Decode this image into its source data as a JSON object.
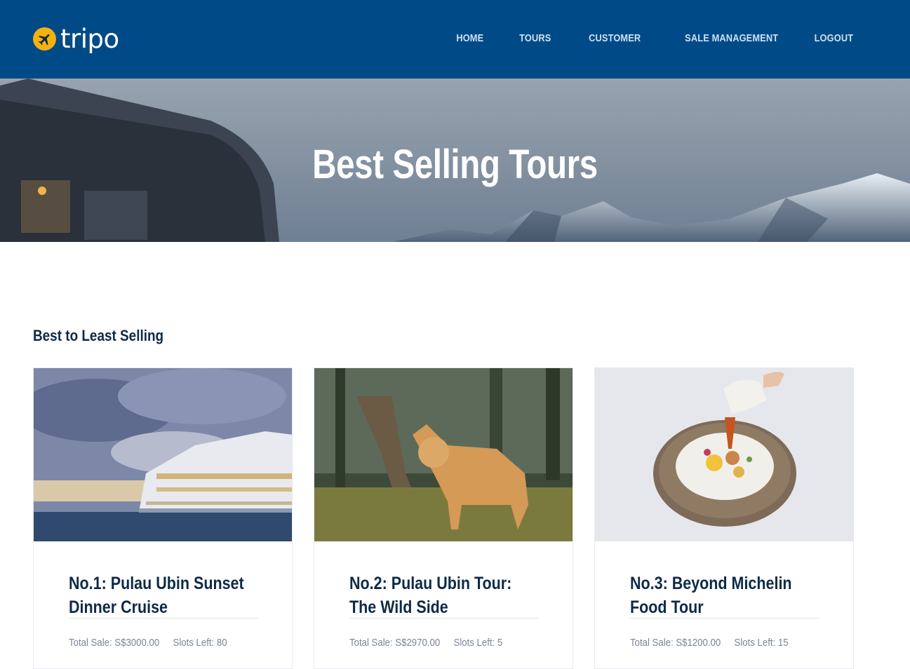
{
  "brand": {
    "name": "tripo",
    "accent": "#f5b20f",
    "header_bg": "#004b87"
  },
  "nav": [
    {
      "label": "HOME"
    },
    {
      "label": "TOURS"
    },
    {
      "label": "CUSTOMER"
    },
    {
      "label": "SALE MANAGEMENT"
    },
    {
      "label": "LOGOUT"
    }
  ],
  "hero": {
    "title": "Best Selling Tours"
  },
  "section": {
    "title": "Best to Least Selling"
  },
  "tours": [
    {
      "title": "No.1: Pulau Ubin Sunset Dinner Cruise",
      "total_sale": "Total Sale: S$3000.00",
      "slots": "Slots Left: 80",
      "image": "cruise-ship"
    },
    {
      "title": "No.2: Pulau Ubin Tour: The Wild Side",
      "total_sale": "Total Sale: S$2970.00",
      "slots": "Slots Left: 5",
      "image": "fox"
    },
    {
      "title": "No.3: Beyond Michelin Food Tour",
      "total_sale": "Total Sale: S$1200.00",
      "slots": "Slots Left: 15",
      "image": "plated-dish"
    }
  ]
}
